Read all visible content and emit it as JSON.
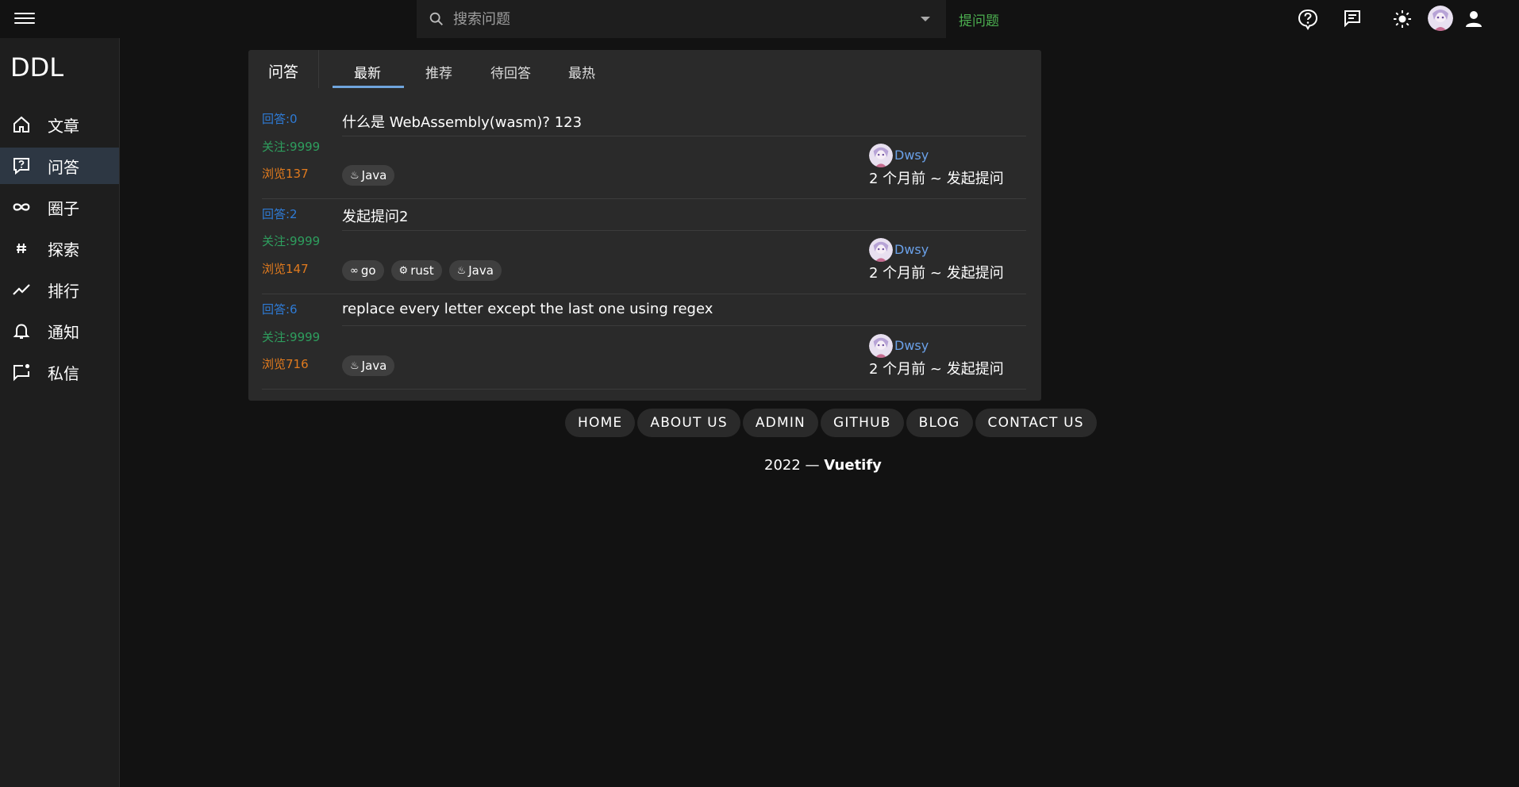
{
  "search": {
    "placeholder": "搜索问题"
  },
  "topbar": {
    "ask_label": "提问题"
  },
  "sidebar": {
    "brand": "DDL",
    "items": [
      {
        "label": "文章",
        "icon": "home-icon"
      },
      {
        "label": "问答",
        "icon": "question-comment-icon",
        "active": true
      },
      {
        "label": "圈子",
        "icon": "infinity-icon"
      },
      {
        "label": "探索",
        "icon": "pound-icon"
      },
      {
        "label": "排行",
        "icon": "trending-icon"
      },
      {
        "label": "通知",
        "icon": "bell-icon"
      },
      {
        "label": "私信",
        "icon": "message-badge-icon"
      }
    ]
  },
  "card": {
    "title": "问答",
    "tabs": [
      "最新",
      "推荐",
      "待回答",
      "最热"
    ],
    "active_tab": "最新",
    "questions": [
      {
        "answers": "回答:0",
        "follows": "关注:9999",
        "views": "浏览137",
        "title": "什么是 WebAssembly(wasm)?  123",
        "tags": [
          {
            "icon": "java-icon",
            "label": "Java"
          }
        ],
        "author": "Dwsy",
        "time": "2 个月前 ~ 发起提问"
      },
      {
        "answers": "回答:2",
        "follows": "关注:9999",
        "views": "浏览147",
        "title": "发起提问2",
        "tags": [
          {
            "icon": "go-icon",
            "label": "go"
          },
          {
            "icon": "rust-icon",
            "label": "rust"
          },
          {
            "icon": "java-icon",
            "label": "Java"
          }
        ],
        "author": "Dwsy",
        "time": "2 个月前 ~ 发起提问"
      },
      {
        "answers": "回答:6",
        "follows": "关注:9999",
        "views": "浏览716",
        "title": "replace every letter except the last one using regex",
        "tags": [
          {
            "icon": "java-icon",
            "label": "Java"
          }
        ],
        "author": "Dwsy",
        "time": "2 个月前 ~ 发起提问"
      }
    ]
  },
  "footer": {
    "links": [
      "HOME",
      "ABOUT US",
      "ADMIN",
      "GITHUB",
      "BLOG",
      "CONTACT US"
    ],
    "year": "2022 —",
    "brand": "Vuetify"
  },
  "colors": {
    "background": "#121212",
    "surface": "#2a2a2a",
    "answers": "#2e7bd6",
    "follows": "#2e9e5e",
    "views": "#e07a1e",
    "author": "#6aa0e8",
    "ask": "#4caf50"
  }
}
